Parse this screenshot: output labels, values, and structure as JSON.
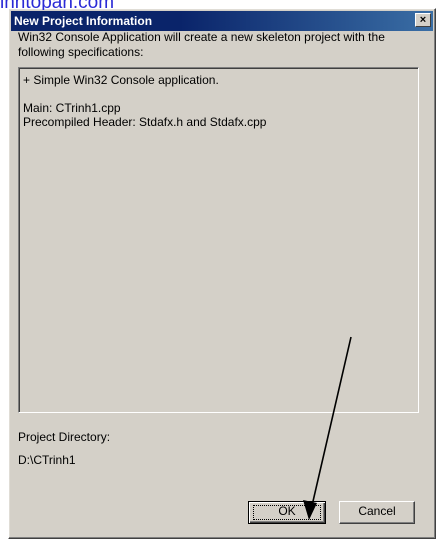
{
  "watermark": {
    "text": "inhtopan.com"
  },
  "dialog": {
    "title": "New Project Information",
    "close_label": "×",
    "description": "Win32 Console Application will create a new skeleton project with the following specifications:",
    "info_lines": [
      "+ Simple Win32 Console application.",
      "",
      "Main: CTrinh1.cpp",
      "Precompiled Header: Stdafx.h and Stdafx.cpp"
    ],
    "project_directory_label": "Project Directory:",
    "project_directory_value": "D:\\CTrinh1",
    "ok_label": "OK",
    "cancel_label": "Cancel"
  },
  "annotation": {
    "arrow_color": "#000000"
  }
}
